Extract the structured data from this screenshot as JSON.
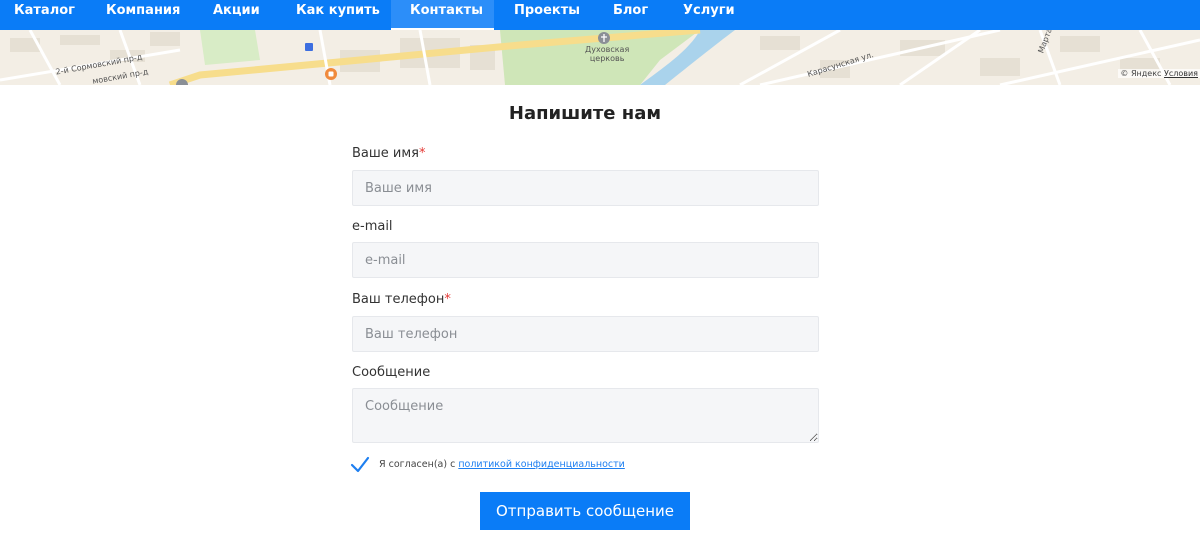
{
  "nav": {
    "items": [
      {
        "label": "Каталог"
      },
      {
        "label": "Компания"
      },
      {
        "label": "Акции"
      },
      {
        "label": "Как купить"
      },
      {
        "label": "Контакты",
        "active": true
      },
      {
        "label": "Проекты"
      },
      {
        "label": "Блог"
      },
      {
        "label": "Услуги"
      }
    ]
  },
  "map": {
    "labels": {
      "street1": "2-й Сормовский пр-д",
      "street2": "мовский пр-д",
      "church": "Духовская\nцерковь",
      "street3": "Карасунская ул.",
      "street4": "Марта"
    },
    "copyright": "© Яндекс",
    "terms": "Условия"
  },
  "form": {
    "title": "Напишите нам",
    "name": {
      "label": "Ваше имя",
      "required": "*",
      "placeholder": "Ваше имя"
    },
    "email": {
      "label": "e-mail",
      "placeholder": "e-mail"
    },
    "phone": {
      "label": "Ваш телефон",
      "required": "*",
      "placeholder": "Ваш телефон"
    },
    "message": {
      "label": "Сообщение",
      "placeholder": "Сообщение"
    },
    "agree_text": "Я согласен(а) с ",
    "agree_link": "политикой конфиденциальности",
    "submit": "Отправить сообщение"
  },
  "colors": {
    "primary": "#0a7cf7",
    "required": "#e53935",
    "link": "#1e7ff0",
    "field_bg": "#f5f6f8"
  },
  "icons": {
    "checkbox": "check-icon",
    "map_church": "church-icon",
    "map_food": "food-icon"
  }
}
